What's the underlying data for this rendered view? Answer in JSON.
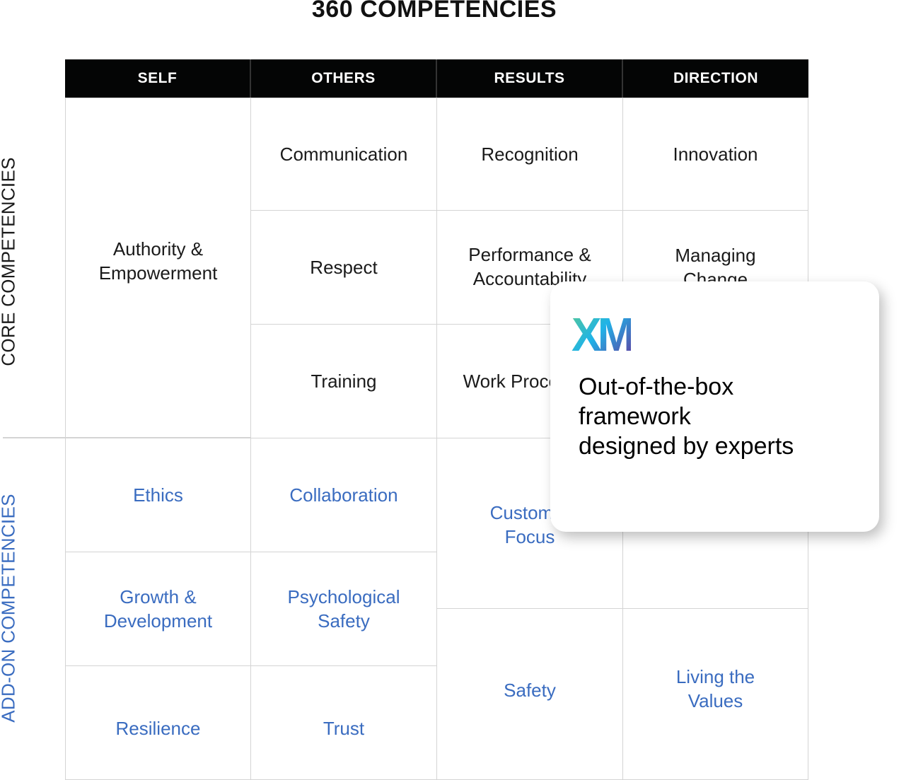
{
  "title": "360 COMPETENCIES",
  "columns": [
    "SELF",
    "OTHERS",
    "RESULTS",
    "DIRECTION"
  ],
  "row_groups": {
    "core": "CORE COMPETENCIES",
    "addon": "ADD-ON COMPETENCIES"
  },
  "core": {
    "self": "Authority &\nEmpowerment",
    "others": [
      "Communication",
      "Respect",
      "Training"
    ],
    "results": [
      "Recognition",
      "Performance &\nAccountability",
      "Work Processes"
    ],
    "direction": [
      "Innovation",
      "Managing\nChange"
    ]
  },
  "addon": {
    "self": [
      "Ethics",
      "Growth &\nDevelopment",
      "Resilience"
    ],
    "others": [
      "Collaboration",
      "Psychological\nSafety",
      "Trust"
    ],
    "results": [
      "Customer\nFocus",
      "Safety"
    ],
    "direction": [
      "Living the\nValues"
    ]
  },
  "card": {
    "logo": "XM",
    "text": "Out-of-the-box\nframework\ndesigned by experts"
  },
  "colors": {
    "header_bg": "#040505",
    "addon_text": "#3a6cc0",
    "logo_gradient": [
      "#4fc6a0",
      "#1fb3e8",
      "#5a4aa8"
    ]
  }
}
